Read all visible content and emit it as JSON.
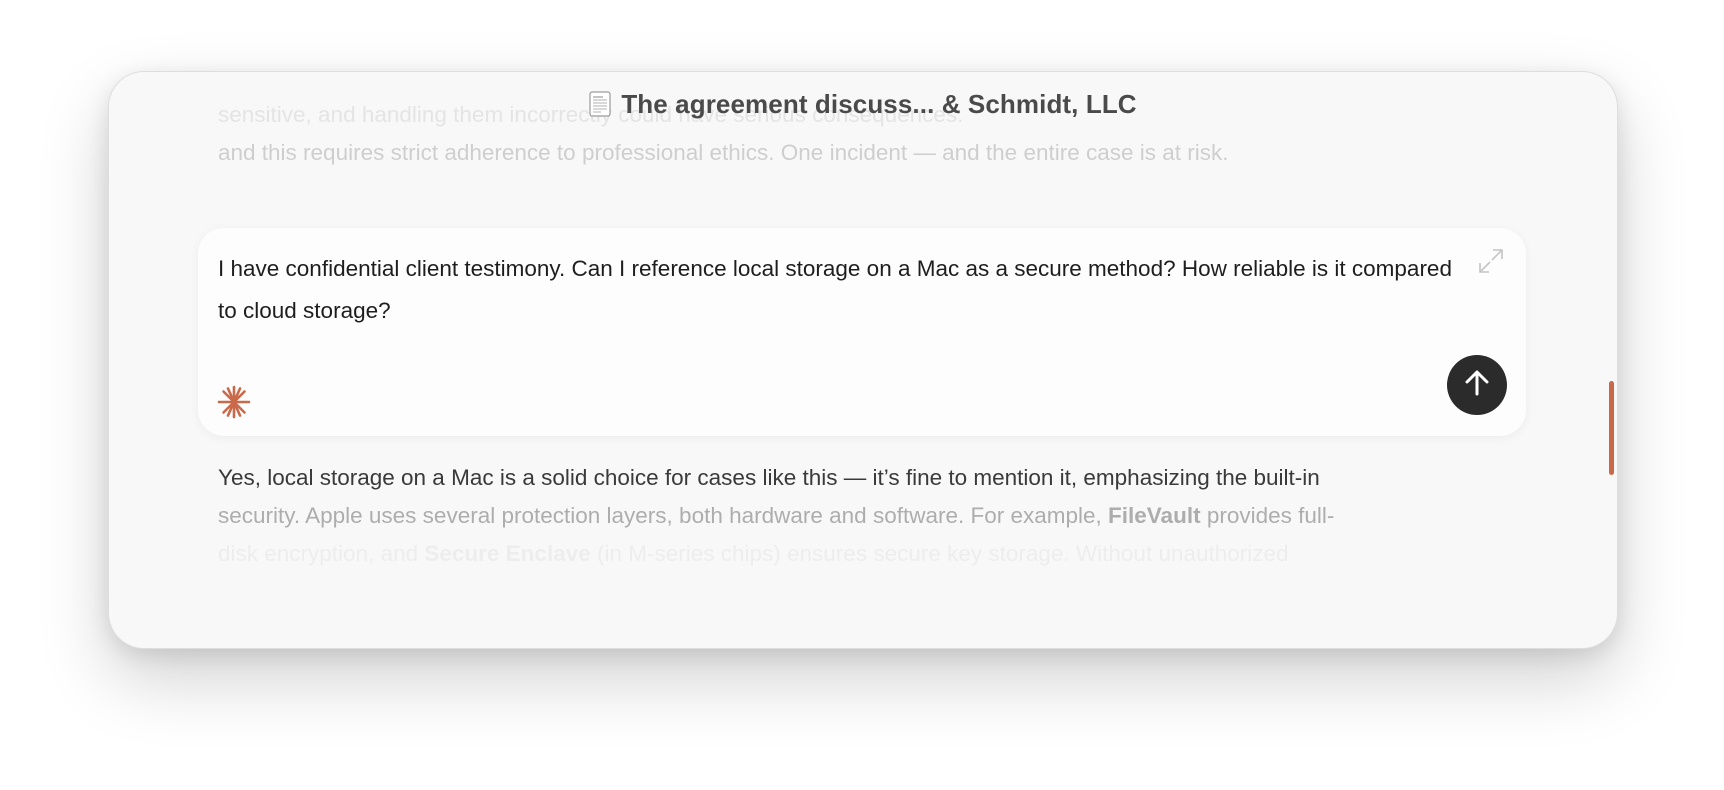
{
  "window": {
    "title": "The agreement discuss... & Schmidt, LLC",
    "title_icon": "document-icon"
  },
  "above_text": {
    "line1": "sensitive, and handling them incorrectly could have serious consequences.",
    "line2": "and this requires strict adherence to professional ethics. One incident — and the entire case is at risk."
  },
  "prompt": {
    "text": "I have confidential client testimony. Can I reference local storage on a Mac as a secure method? How reliable is it compared to cloud storage?",
    "expand_icon": "expand-icon",
    "sparkle_icon": "sparkle-icon",
    "send_icon": "arrow-up-icon"
  },
  "response": {
    "line1": "Yes, local storage on a Mac is a solid choice for cases like this — it’s fine to mention it, emphasizing the built-in",
    "line2_pre": "security. Apple uses several protection layers, both hardware and software. For example, ",
    "line2_bold": "FileVault",
    "line2_post": " provides full-",
    "line3_pre": "disk encryption, and ",
    "line3_bold": "Secure Enclave",
    "line3_post": " (in M-series chips) ensures secure key storage. Without unauthorized"
  },
  "colors": {
    "accent": "#c9694a",
    "send_button": "#2b2b2b",
    "window_bg": "#f8f8f8"
  }
}
